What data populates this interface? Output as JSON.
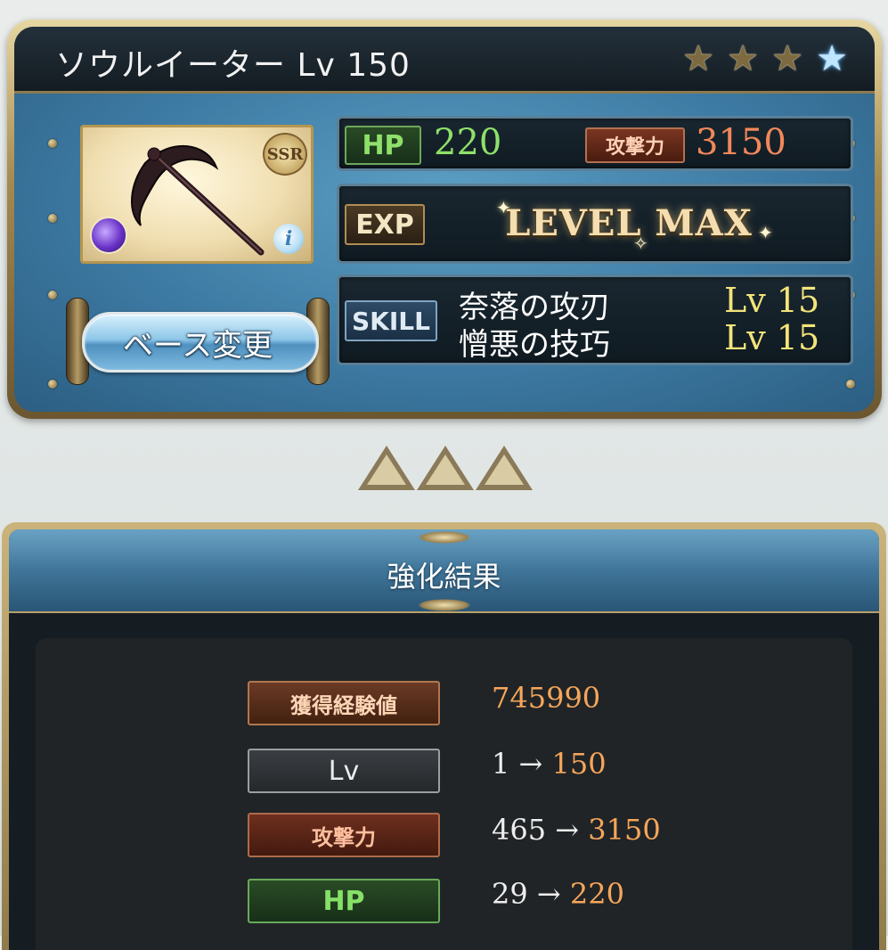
{
  "weapon": {
    "name": "ソウルイーター Lv 150",
    "rarity": "SSR",
    "stars_filled": 3,
    "stars_total": 4,
    "element": "dark",
    "info_label": "i"
  },
  "base_change": {
    "label": "ベース変更"
  },
  "stats": {
    "hp_label": "HP",
    "hp_value": "220",
    "atk_label": "攻撃力",
    "atk_value": "3150",
    "exp_label": "EXP",
    "exp_status": "LEVEL MAX",
    "skill_label": "SKILL",
    "skills": [
      {
        "name": "奈落の攻刃",
        "level": "Lv 15"
      },
      {
        "name": "憎悪の技巧",
        "level": "Lv 15"
      }
    ]
  },
  "result": {
    "title": "強化結果",
    "rows": [
      {
        "label": "獲得経験値",
        "from": "",
        "arrow": "",
        "to": "745990"
      },
      {
        "label": "Lv",
        "from": "1",
        "arrow": "→",
        "to": "150"
      },
      {
        "label": "攻撃力",
        "from": "465",
        "arrow": "→",
        "to": "3150"
      },
      {
        "label": "HP",
        "from": "29",
        "arrow": "→",
        "to": "220"
      }
    ]
  },
  "colors": {
    "hp_green": "#8fe06a",
    "atk_orange": "#f2885a",
    "skill_level_yellow": "#f3e47a",
    "result_accent": "#f6a65a"
  }
}
